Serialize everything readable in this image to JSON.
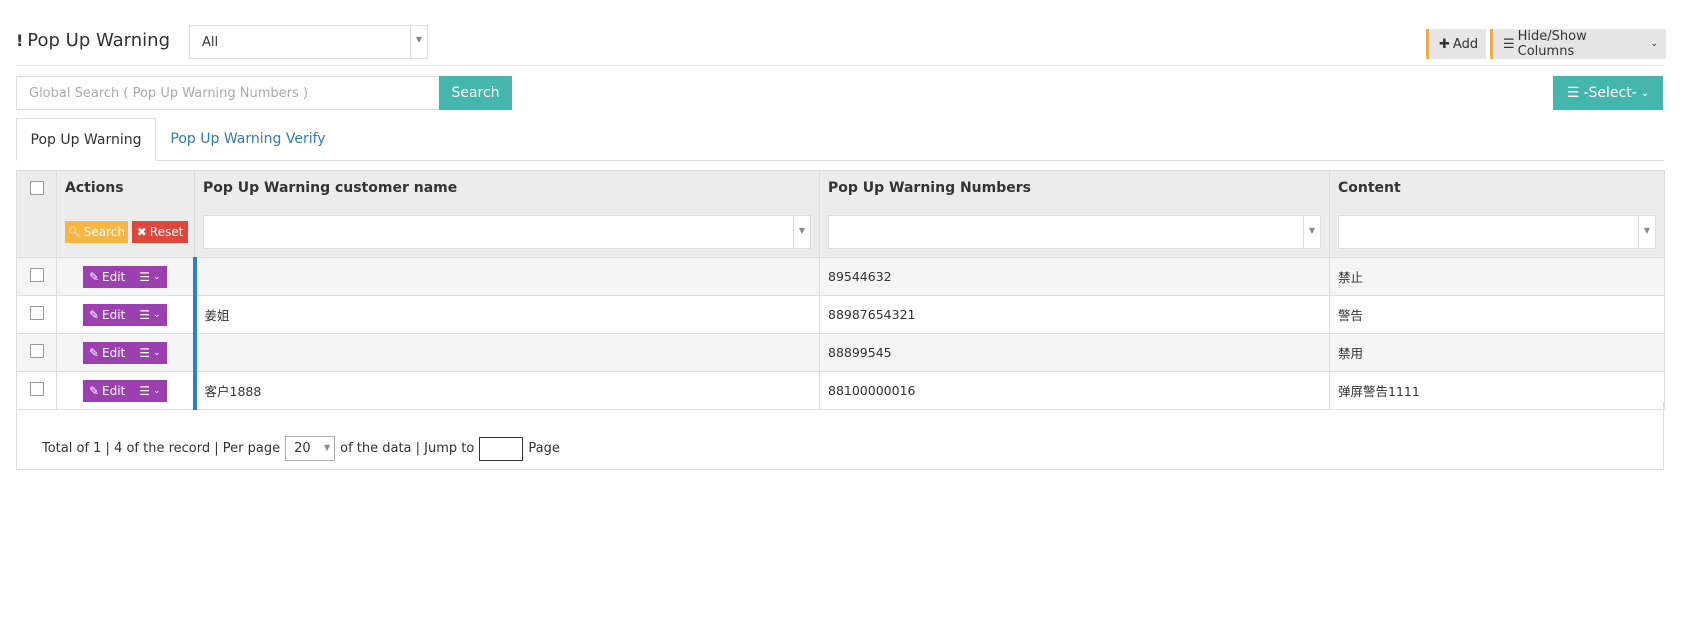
{
  "page": {
    "title": "Pop Up Warning",
    "title_marker": "!",
    "filter_value": "All"
  },
  "toolbar": {
    "add_label": "Add",
    "columns_label": "Hide/Show Columns",
    "select_label": "-Select-"
  },
  "search": {
    "placeholder": "Global Search ( Pop Up Warning Numbers )",
    "button_label": "Search"
  },
  "tabs": [
    {
      "label": "Pop Up Warning",
      "active": true
    },
    {
      "label": "Pop Up Warning Verify",
      "active": false
    }
  ],
  "table": {
    "columns": {
      "actions": "Actions",
      "customer_name": "Pop Up Warning customer name",
      "numbers": "Pop Up Warning Numbers",
      "content": "Content"
    },
    "header_search_label": "Search",
    "header_reset_label": "Reset",
    "edit_label": "Edit",
    "rows": [
      {
        "name": "",
        "number": "89544632",
        "content": "禁止"
      },
      {
        "name": "姜姐",
        "number": "88987654321",
        "content": "警告"
      },
      {
        "name": "",
        "number": "88899545",
        "content": "禁用"
      },
      {
        "name": "客户1888",
        "number": "88100000016",
        "content": "弹屏警告1111"
      }
    ]
  },
  "pagination": {
    "summary": "Total of 1 | 4 of the record | Per page",
    "per_page": "20",
    "of_data": "of the data | Jump to",
    "page_word": "Page"
  },
  "colors": {
    "teal": "#45b6ad",
    "purple": "#9b3fb1",
    "orange": "#f7b544",
    "red": "#e0463b",
    "link_blue": "#337ab7",
    "row_marker_blue": "#2f7fcf"
  }
}
